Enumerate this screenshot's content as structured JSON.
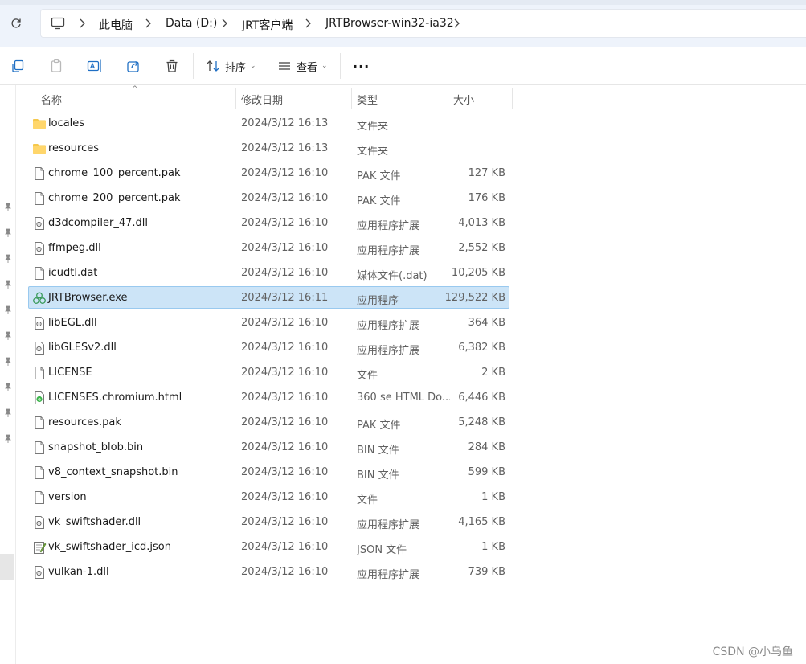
{
  "breadcrumb": [
    {
      "label": "此电脑"
    },
    {
      "label": "Data (D:)"
    },
    {
      "label": "JRT客户端"
    },
    {
      "label": "JRTBrowser-win32-ia32"
    }
  ],
  "toolbar": {
    "sort_label": "排序",
    "view_label": "查看",
    "more_label": "···"
  },
  "columns": {
    "name": "名称",
    "date": "修改日期",
    "type": "类型",
    "size": "大小"
  },
  "files": [
    {
      "name": "locales",
      "date": "2024/3/12 16:13",
      "type": "文件夹",
      "size": "",
      "icon": "folder-icon"
    },
    {
      "name": "resources",
      "date": "2024/3/12 16:13",
      "type": "文件夹",
      "size": "",
      "icon": "folder-icon"
    },
    {
      "name": "chrome_100_percent.pak",
      "date": "2024/3/12 16:10",
      "type": "PAK 文件",
      "size": "127 KB",
      "icon": "file-icon"
    },
    {
      "name": "chrome_200_percent.pak",
      "date": "2024/3/12 16:10",
      "type": "PAK 文件",
      "size": "176 KB",
      "icon": "file-icon"
    },
    {
      "name": "d3dcompiler_47.dll",
      "date": "2024/3/12 16:10",
      "type": "应用程序扩展",
      "size": "4,013 KB",
      "icon": "dll-icon"
    },
    {
      "name": "ffmpeg.dll",
      "date": "2024/3/12 16:10",
      "type": "应用程序扩展",
      "size": "2,552 KB",
      "icon": "dll-icon"
    },
    {
      "name": "icudtl.dat",
      "date": "2024/3/12 16:10",
      "type": "媒体文件(.dat)",
      "size": "10,205 KB",
      "icon": "file-icon"
    },
    {
      "name": "JRTBrowser.exe",
      "date": "2024/3/12 16:11",
      "type": "应用程序",
      "size": "129,522 KB",
      "icon": "exe-icon",
      "selected": true
    },
    {
      "name": "libEGL.dll",
      "date": "2024/3/12 16:10",
      "type": "应用程序扩展",
      "size": "364 KB",
      "icon": "dll-icon"
    },
    {
      "name": "libGLESv2.dll",
      "date": "2024/3/12 16:10",
      "type": "应用程序扩展",
      "size": "6,382 KB",
      "icon": "dll-icon"
    },
    {
      "name": "LICENSE",
      "date": "2024/3/12 16:10",
      "type": "文件",
      "size": "2 KB",
      "icon": "file-icon"
    },
    {
      "name": "LICENSES.chromium.html",
      "date": "2024/3/12 16:10",
      "type": "360 se HTML Do...",
      "size": "6,446 KB",
      "icon": "html-icon"
    },
    {
      "name": "resources.pak",
      "date": "2024/3/12 16:10",
      "type": "PAK 文件",
      "size": "5,248 KB",
      "icon": "file-icon"
    },
    {
      "name": "snapshot_blob.bin",
      "date": "2024/3/12 16:10",
      "type": "BIN 文件",
      "size": "284 KB",
      "icon": "file-icon"
    },
    {
      "name": "v8_context_snapshot.bin",
      "date": "2024/3/12 16:10",
      "type": "BIN 文件",
      "size": "599 KB",
      "icon": "file-icon"
    },
    {
      "name": "version",
      "date": "2024/3/12 16:10",
      "type": "文件",
      "size": "1 KB",
      "icon": "file-icon"
    },
    {
      "name": "vk_swiftshader.dll",
      "date": "2024/3/12 16:10",
      "type": "应用程序扩展",
      "size": "4,165 KB",
      "icon": "dll-icon"
    },
    {
      "name": "vk_swiftshader_icd.json",
      "date": "2024/3/12 16:10",
      "type": "JSON 文件",
      "size": "1 KB",
      "icon": "json-icon"
    },
    {
      "name": "vulkan-1.dll",
      "date": "2024/3/12 16:10",
      "type": "应用程序扩展",
      "size": "739 KB",
      "icon": "dll-icon"
    }
  ],
  "watermark": "CSDN @小乌鱼",
  "colors": {
    "selection_bg": "#cce4f7",
    "selection_border": "#99c9ef",
    "folder": "#f5c84c",
    "address_bg": "#eef3fb"
  }
}
